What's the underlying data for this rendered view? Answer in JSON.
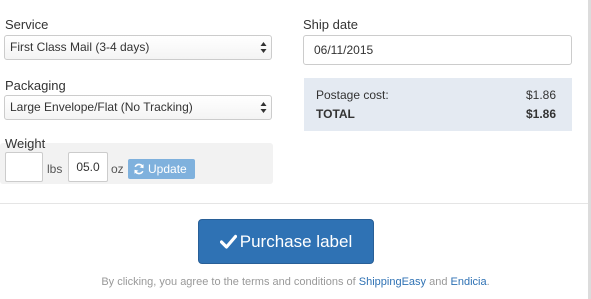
{
  "service": {
    "label": "Service",
    "selected": "First Class Mail (3-4 days)"
  },
  "packaging": {
    "label": "Packaging",
    "selected": "Large Envelope/Flat (No Tracking)"
  },
  "weight": {
    "label": "Weight",
    "lbs_value": "",
    "lbs_unit": "lbs",
    "oz_value": "05.0",
    "oz_unit": "oz",
    "update_label": "Update"
  },
  "ship_date": {
    "label": "Ship date",
    "value": "06/11/2015"
  },
  "cost": {
    "postage_label": "Postage cost:",
    "postage_value": "$1.86",
    "total_label": "TOTAL",
    "total_value": "$1.86"
  },
  "purchase": {
    "label": "Purchase label",
    "icon": "check-icon"
  },
  "terms": {
    "prefix": "By clicking, you agree to the terms and conditions of",
    "link1": "ShippingEasy",
    "middle": "and",
    "link2": "Endicia",
    "suffix": "."
  },
  "colors": {
    "primary": "#2f72b4",
    "update_button": "#7fb1dd",
    "cost_box": "#e4eaf2"
  }
}
